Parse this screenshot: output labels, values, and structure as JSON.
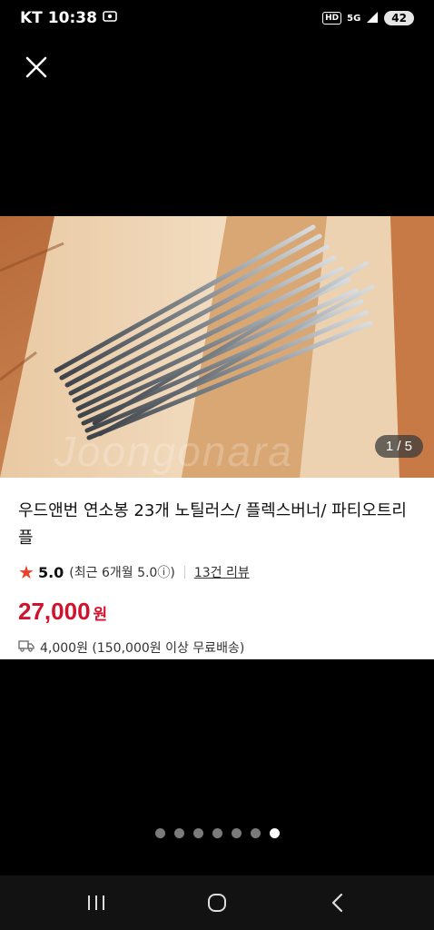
{
  "status_bar": {
    "carrier": "KT",
    "time": "10:38",
    "hd_label": "HD",
    "network_label": "5G",
    "battery": "42"
  },
  "gallery": {
    "page_indicator": "1 / 5",
    "watermark": "Joongonara",
    "dots_count": 7,
    "active_dot": 6
  },
  "product": {
    "title": "우드앤번 연소봉 23개 노틸러스/ 플렉스버너/ 파티오트리플",
    "rating": "5.0",
    "recent_rating": "(최근 6개월 5.0ⓘ)",
    "reviews": "13건 리뷰",
    "price": "27,000",
    "currency": "원",
    "shipping": "4,000원 (150,000원 이상 무료배송)"
  },
  "icons": {
    "close": "close-icon",
    "star": "star-icon",
    "truck": "truck-icon",
    "recents": "recents-icon",
    "home": "home-icon",
    "back": "back-icon"
  },
  "colors": {
    "price": "#d0122c",
    "star": "#e8422b",
    "background": "#000000"
  }
}
